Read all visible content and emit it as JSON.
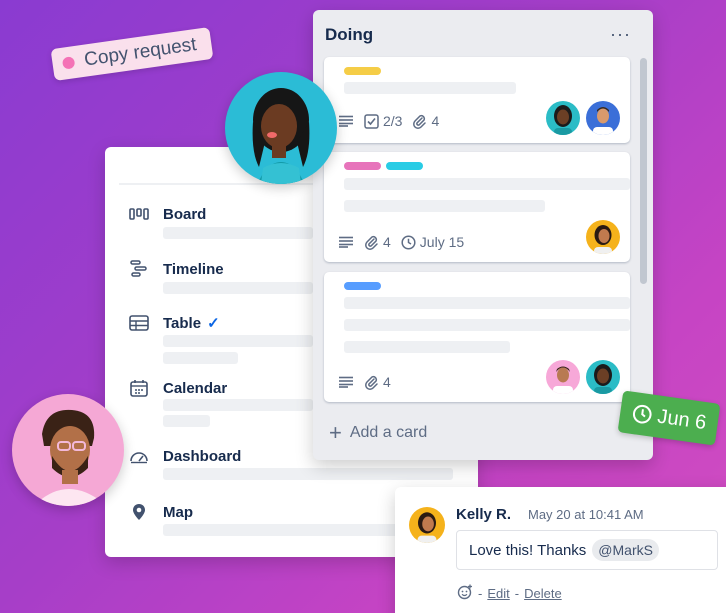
{
  "tag": {
    "label": "Copy request",
    "dot_color": "#f472b6"
  },
  "views": {
    "items": [
      {
        "label": "Board",
        "icon": "board-icon"
      },
      {
        "label": "Timeline",
        "icon": "timeline-icon"
      },
      {
        "label": "Table",
        "icon": "table-icon",
        "checked": true
      },
      {
        "label": "Calendar",
        "icon": "calendar-icon"
      },
      {
        "label": "Dashboard",
        "icon": "dashboard-icon"
      },
      {
        "label": "Map",
        "icon": "map-pin-icon"
      }
    ]
  },
  "list": {
    "title": "Doing",
    "menu": "···",
    "add_card": "Add a card",
    "cards": [
      {
        "labels": [
          "#f5cd47"
        ],
        "checklist": "2/3",
        "attachments": "4",
        "members": [
          "member-woman-locs",
          "member-man-blue"
        ]
      },
      {
        "labels": [
          "#e774bb",
          "#29cce5"
        ],
        "attachments": "4",
        "due": "July 15",
        "members": [
          "member-woman-yellow"
        ]
      },
      {
        "labels": [
          "#579dff"
        ],
        "attachments": "4",
        "members": [
          "member-man-pink",
          "member-woman-teal"
        ]
      }
    ]
  },
  "due_badge": {
    "label": "Jun 6",
    "color": "#4cae4f"
  },
  "comment": {
    "author": "Kelly R.",
    "time": "May 20 at 10:41 AM",
    "text": "Love this! Thanks",
    "mention": "@MarkS",
    "edit": "Edit",
    "delete": "Delete",
    "separator": "-"
  }
}
